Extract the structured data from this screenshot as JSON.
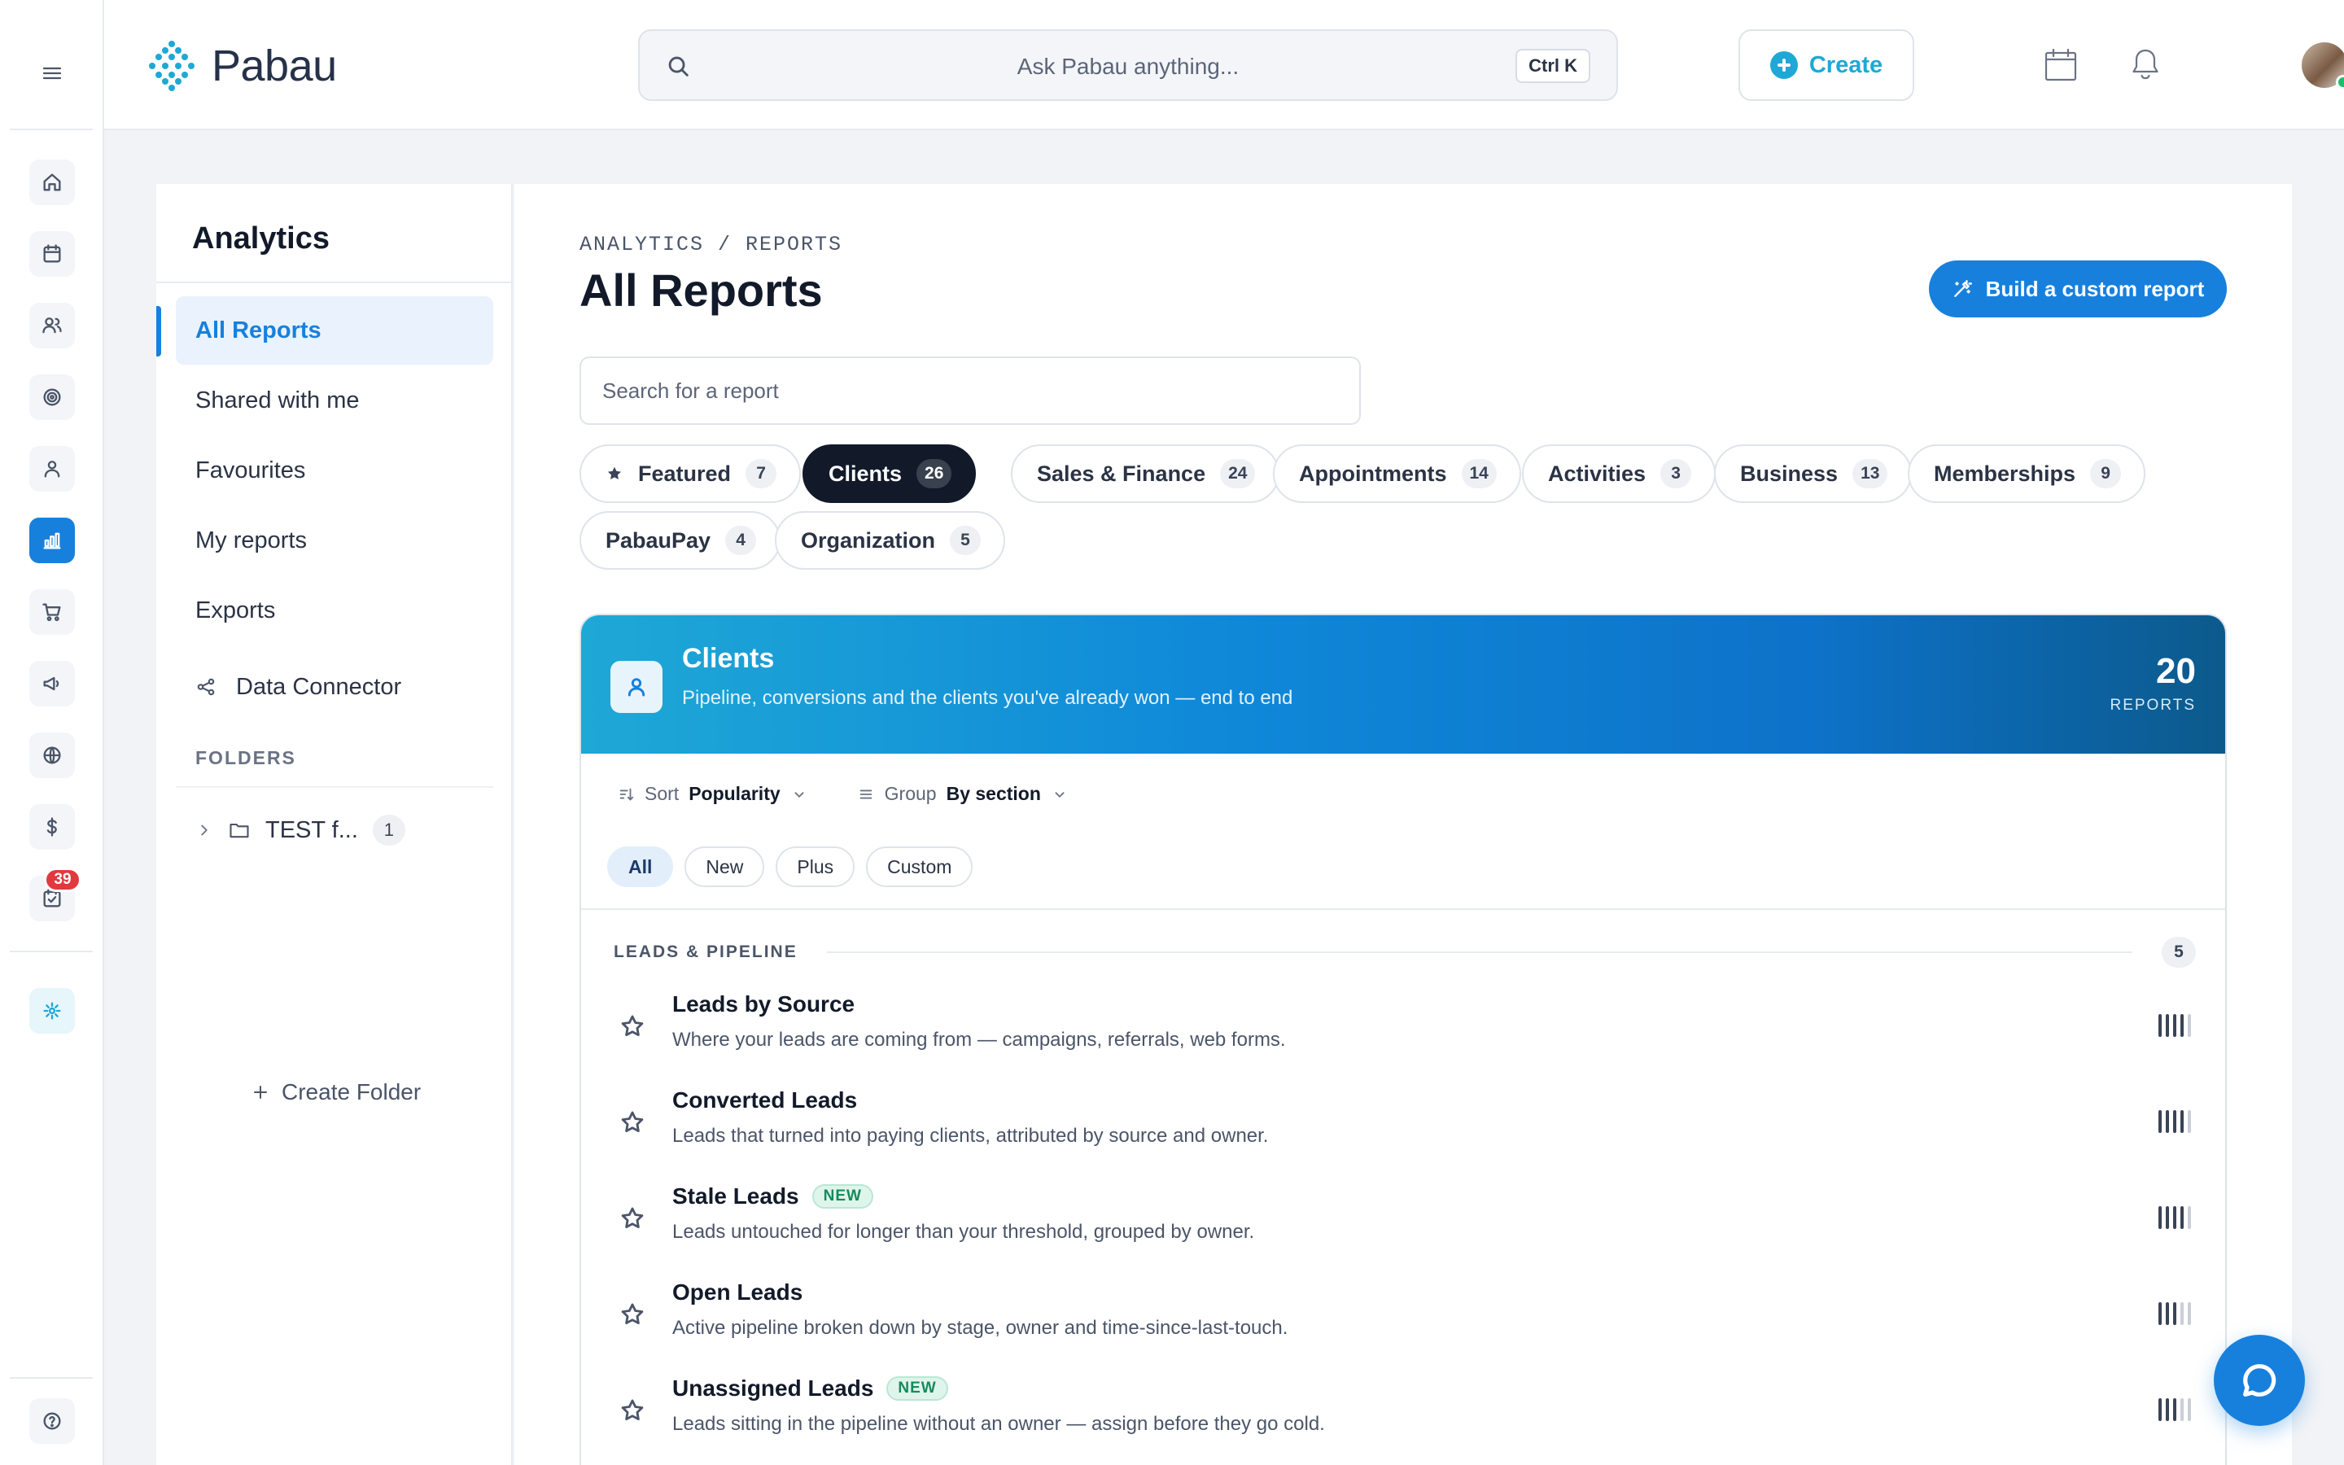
{
  "app": {
    "logo_text": "Pabau",
    "brand_color": "#1ea8d6",
    "accent_color": "#1780dd"
  },
  "topbar": {
    "search_placeholder": "Ask Pabau anything...",
    "search_shortcut": "Ctrl K",
    "create_label": "Create",
    "icons": [
      "calendar-icon",
      "bell-icon",
      "avatar",
      "chevron-down-icon"
    ]
  },
  "rail": {
    "items": [
      {
        "icon": "home-icon"
      },
      {
        "icon": "calendar-icon"
      },
      {
        "icon": "users-icon"
      },
      {
        "icon": "target-icon"
      },
      {
        "icon": "user-icon"
      },
      {
        "icon": "analytics-icon",
        "active": true
      },
      {
        "icon": "cart-icon"
      },
      {
        "icon": "megaphone-icon"
      },
      {
        "icon": "globe-icon"
      },
      {
        "icon": "dollar-icon"
      },
      {
        "icon": "tasks-icon",
        "badge": "39"
      },
      {
        "icon": "brand-icon"
      },
      {
        "icon": "help-icon"
      }
    ],
    "tasks_badge": "39"
  },
  "sidebar": {
    "title": "Analytics",
    "items": [
      {
        "label": "All Reports",
        "active": true
      },
      {
        "label": "Shared with me"
      },
      {
        "label": "Favourites"
      },
      {
        "label": "My reports"
      },
      {
        "label": "Exports"
      },
      {
        "label": "Data Connector",
        "icon": "share-icon"
      }
    ],
    "folders_label": "FOLDERS",
    "folders": [
      {
        "name": "TEST f...",
        "count": "1"
      }
    ],
    "create_folder_label": "Create Folder"
  },
  "main": {
    "breadcrumb": "ANALYTICS / REPORTS",
    "title": "All Reports",
    "build_label": "Build a custom report",
    "search_placeholder": "Search for a report",
    "tabs": [
      {
        "label": "Featured",
        "count": "7",
        "icon": "star-icon"
      },
      {
        "label": "Clients",
        "count": "26",
        "active": true
      },
      {
        "label": "Sales & Finance",
        "count": "24"
      },
      {
        "label": "Appointments",
        "count": "14"
      },
      {
        "label": "Activities",
        "count": "3"
      },
      {
        "label": "Business",
        "count": "13"
      },
      {
        "label": "Memberships",
        "count": "9"
      },
      {
        "label": "PabauPay",
        "count": "4"
      },
      {
        "label": "Organization",
        "count": "5"
      }
    ],
    "category": {
      "title": "Clients",
      "description": "Pipeline, conversions and the clients you've already won — end to end",
      "count": "20",
      "count_label": "REPORTS",
      "sort_label": "Sort",
      "sort_value": "Popularity",
      "group_label": "Group",
      "group_value": "By section",
      "filters": [
        {
          "label": "All",
          "active": true
        },
        {
          "label": "New"
        },
        {
          "label": "Plus"
        },
        {
          "label": "Custom"
        }
      ],
      "section": {
        "title": "LEADS & PIPELINE",
        "count": "5"
      },
      "reports": [
        {
          "name": "Leads by Source",
          "description": "Where your leads are coming from — campaigns, referrals, web forms.",
          "popularity": 4
        },
        {
          "name": "Converted Leads",
          "description": "Leads that turned into paying clients, attributed by source and owner.",
          "popularity": 4
        },
        {
          "name": "Stale Leads",
          "badge": "NEW",
          "description": "Leads untouched for longer than your threshold, grouped by owner.",
          "popularity": 4
        },
        {
          "name": "Open Leads",
          "description": "Active pipeline broken down by stage, owner and time-since-last-touch.",
          "popularity": 3
        },
        {
          "name": "Unassigned Leads",
          "badge": "NEW",
          "description": "Leads sitting in the pipeline without an owner — assign before they go cold.",
          "popularity": 3
        }
      ]
    }
  },
  "chat": {
    "icon": "chat-icon"
  }
}
